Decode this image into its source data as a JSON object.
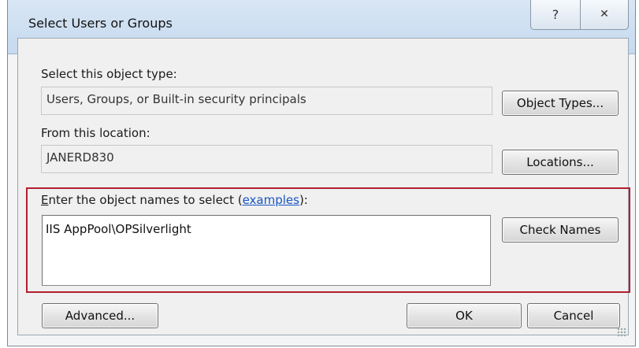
{
  "dialog": {
    "title": "Select Users or Groups",
    "help_glyph": "?",
    "close_glyph": "✕"
  },
  "object_type": {
    "label": "Select this object type:",
    "value": "Users, Groups, or Built-in security principals",
    "button": "Object Types..."
  },
  "location": {
    "label": "From this location:",
    "value": "JANERD830",
    "button": "Locations..."
  },
  "names": {
    "label_prefix": "Enter the object names to select (",
    "link_text": "examples",
    "label_suffix": "):",
    "value": "IIS AppPool\\OPSilverlight",
    "check_button": "Check Names"
  },
  "footer": {
    "advanced": "Advanced...",
    "ok": "OK",
    "cancel": "Cancel"
  },
  "colors": {
    "highlight_border": "#b21f2d",
    "link": "#1a55c4",
    "title_band": "#cddff1"
  },
  "icons": [
    "help-icon",
    "close-icon",
    "resize-grip-icon"
  ]
}
